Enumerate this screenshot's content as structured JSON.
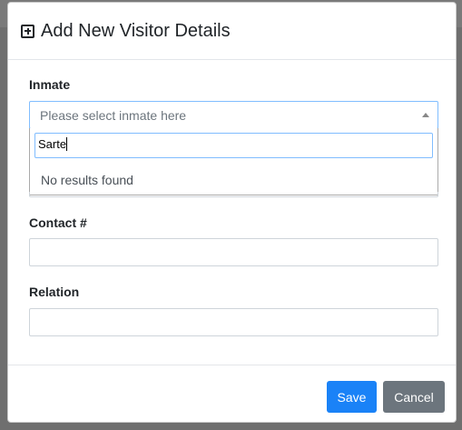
{
  "background": {
    "fragments": [
      "",
      ""
    ]
  },
  "modal": {
    "title": "Add New Visitor Details",
    "title_icon": "plus-square-icon"
  },
  "form": {
    "inmate": {
      "label": "Inmate",
      "placeholder": "Please select inmate here",
      "search_value": "Sarte",
      "no_results": "No results found"
    },
    "contact": {
      "label": "Contact #",
      "value": ""
    },
    "relation": {
      "label": "Relation",
      "value": ""
    }
  },
  "footer": {
    "save_label": "Save",
    "cancel_label": "Cancel"
  },
  "colors": {
    "primary": "#1a82f7",
    "secondary": "#6c757d",
    "focus_border": "#80bdff"
  }
}
